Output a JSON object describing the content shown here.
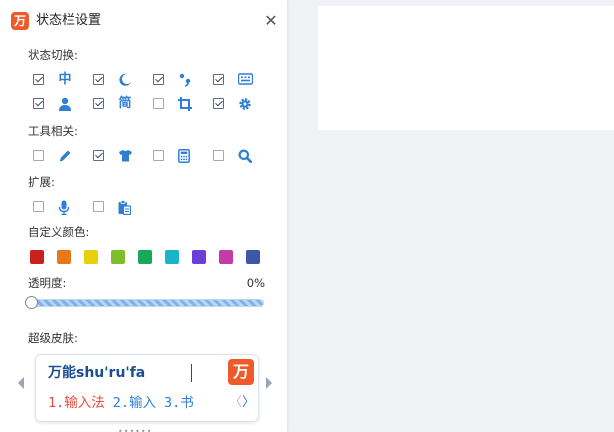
{
  "window": {
    "title": "状态栏设置",
    "logo_glyph": "万",
    "close_glyph": "✕"
  },
  "status_toggle": {
    "label": "状态切换:",
    "items": [
      {
        "icon": "chinese-mode-icon",
        "glyph": "中",
        "checked": true
      },
      {
        "icon": "moon-icon",
        "glyph": "",
        "checked": true
      },
      {
        "icon": "punctuation-icon",
        "glyph": "",
        "checked": true
      },
      {
        "icon": "keyboard-icon",
        "glyph": "",
        "checked": true
      },
      {
        "icon": "user-icon",
        "glyph": "",
        "checked": true
      },
      {
        "icon": "simplified-chinese-icon",
        "glyph": "简",
        "checked": true
      },
      {
        "icon": "crop-icon",
        "glyph": "",
        "checked": false
      },
      {
        "icon": "gear-icon",
        "glyph": "",
        "checked": true
      }
    ]
  },
  "tools": {
    "label": "工具相关:",
    "items": [
      {
        "icon": "pencil-icon",
        "checked": false
      },
      {
        "icon": "tshirt-icon",
        "checked": true
      },
      {
        "icon": "calculator-icon",
        "checked": false
      },
      {
        "icon": "search-icon",
        "checked": false
      }
    ]
  },
  "extend": {
    "label": "扩展:",
    "items": [
      {
        "icon": "microphone-icon",
        "checked": false
      },
      {
        "icon": "clipboard-icon",
        "checked": false
      }
    ]
  },
  "custom_color": {
    "label": "自定义颜色:",
    "swatches": [
      "#c9221c",
      "#e8771a",
      "#e8d10c",
      "#7cbf2a",
      "#18a85a",
      "#1ab3c9",
      "#6a3fd8",
      "#c43aa6",
      "#3d56a8"
    ]
  },
  "opacity": {
    "label": "透明度:",
    "value_text": "0%",
    "value": 0
  },
  "skin": {
    "label": "超级皮肤:",
    "preview_text": "万能shu'ru'fa",
    "logo_glyph": "万",
    "candidates": [
      "1.输入法",
      "2.输入",
      "3.书"
    ],
    "prev_glyph": "〈",
    "next_glyph": "〉"
  },
  "colors": {
    "accent": "#2f7fd5",
    "brand": "#f0592a"
  }
}
